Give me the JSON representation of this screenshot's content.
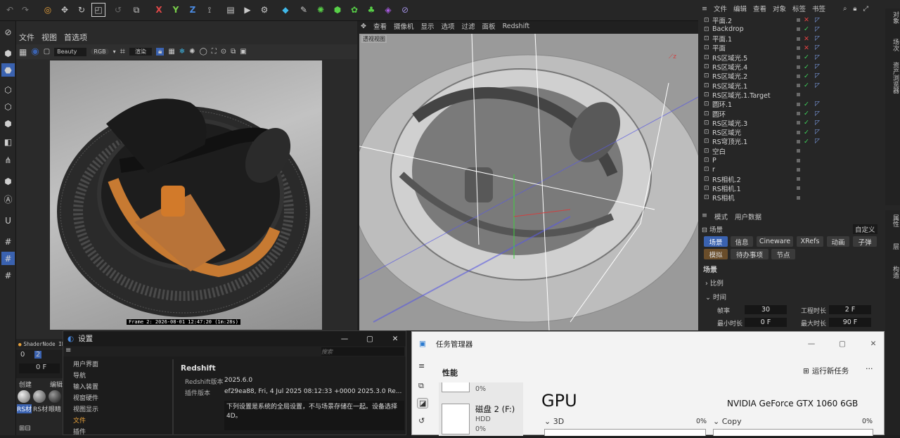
{
  "top_toolbar": {
    "icons": [
      "undo-icon",
      "redo-icon",
      "live-select-icon",
      "move-icon",
      "rotate-icon",
      "scale-icon",
      "transform-icon",
      "coordinate-icon",
      "x-axis-icon",
      "y-axis-icon",
      "z-axis-icon",
      "world-axis-icon",
      "render-region-icon",
      "render-view-icon",
      "render-settings-icon",
      "cube-icon",
      "pen-icon",
      "subdivide-icon",
      "generator-icon",
      "cloner-icon",
      "mograph-icon",
      "deformer-icon",
      "tag-icon"
    ],
    "axis_x": "X",
    "axis_y": "Y",
    "axis_z": "Z"
  },
  "viewport1": {
    "menu": [
      "文件",
      "视图",
      "首选项"
    ],
    "render_pass": "Beauty",
    "color_mode": "RGB",
    "render_mode": "渲染",
    "frame_caption": "Frame 2:  2026-08-01  12:47:20  (1m:28s)",
    "shader_node": "ShaderNode IP",
    "timeline_numbers": [
      "0",
      "2"
    ],
    "frame_field": "0 F",
    "material_tabs": [
      "创建",
      "编辑"
    ],
    "materials": [
      "RS材",
      "RS材",
      "眼睛"
    ]
  },
  "viewport2": {
    "menu": [
      "查看",
      "摄像机",
      "显示",
      "选项",
      "过滤",
      "面板",
      "Redshift"
    ],
    "view_label": "透视视图"
  },
  "object_manager": {
    "menu": [
      "文件",
      "编辑",
      "查看",
      "对象",
      "标签",
      "书签"
    ],
    "side_tab": "对象",
    "side_tab2": "场次",
    "side_tab3": "资产浏览器",
    "objects": [
      {
        "name": "平面.2",
        "status": "x"
      },
      {
        "name": "Backdrop",
        "status": "check"
      },
      {
        "name": "平面.1",
        "status": "x"
      },
      {
        "name": "平面",
        "status": "x"
      },
      {
        "name": "RS区域光.5",
        "status": "check"
      },
      {
        "name": "RS区域光.4",
        "status": "check"
      },
      {
        "name": "RS区域光.2",
        "status": "check"
      },
      {
        "name": "RS区域光.1",
        "status": "check"
      },
      {
        "name": "RS区域光.1.Target",
        "status": ""
      },
      {
        "name": "圆环.1",
        "status": "check"
      },
      {
        "name": "圆环",
        "status": "check"
      },
      {
        "name": "RS区域光.3",
        "status": "check"
      },
      {
        "name": "RS区域光",
        "status": "check"
      },
      {
        "name": "RS穹顶光.1",
        "status": "check"
      },
      {
        "name": "空白",
        "status": ""
      },
      {
        "name": "P",
        "status": ""
      },
      {
        "name": "r",
        "status": ""
      },
      {
        "name": "RS相机.2",
        "status": ""
      },
      {
        "name": "RS相机.1",
        "status": ""
      },
      {
        "name": "RS相机",
        "status": ""
      }
    ]
  },
  "attribute_manager": {
    "menu": [
      "模式",
      "用户数据"
    ],
    "section": "场景",
    "custom_dropdown": "自定义",
    "tabs_row1": [
      "场景",
      "信息",
      "Cineware",
      "XRefs",
      "动画",
      "子弹"
    ],
    "tabs_row2": [
      "模拟",
      "待办事项",
      "节点"
    ],
    "heading": "场景",
    "group1": "比例",
    "group2": "时间",
    "fps_label": "帧率",
    "fps_value": "30",
    "project_len_label": "工程时长",
    "project_len_value": "2 F",
    "min_len_label": "最小时长",
    "min_len_value": "0 F",
    "max_len_label": "最大时长",
    "max_len_value": "90 F",
    "side_tabs": [
      "属性",
      "层",
      "构造"
    ]
  },
  "settings_dialog": {
    "title": "设置",
    "search_placeholder": "搜索",
    "nav": [
      "用户界面",
      "导航",
      "输入装置",
      "视窗硬件",
      "视图显示",
      "文件",
      "插件"
    ],
    "active_nav": "文件",
    "heading": "Redshift",
    "version_label": "Redshift版本",
    "version_value": "2025.6.0",
    "plugin_label": "插件版本",
    "plugin_value": "ef29ea88, Fri, 4 Jul 2025 08:12:33 +0000 2025.3.0 Re...",
    "note": "下列设置是系统的全局设置，不与场景存储在一起。设备选择 4D。"
  },
  "task_manager": {
    "title": "任务管理器",
    "section": "性能",
    "run_task": "运行新任务",
    "more": "···",
    "item_top_pct": "0%",
    "disk_name": "磁盘 2 (F:)",
    "disk_type": "HDD",
    "disk_pct": "0%",
    "gpu_title": "GPU",
    "gpu_model": "NVIDIA GeForce GTX 1060 6GB",
    "engine1": "3D",
    "engine1_pct": "0%",
    "engine2": "Copy",
    "engine2_pct": "0%"
  }
}
